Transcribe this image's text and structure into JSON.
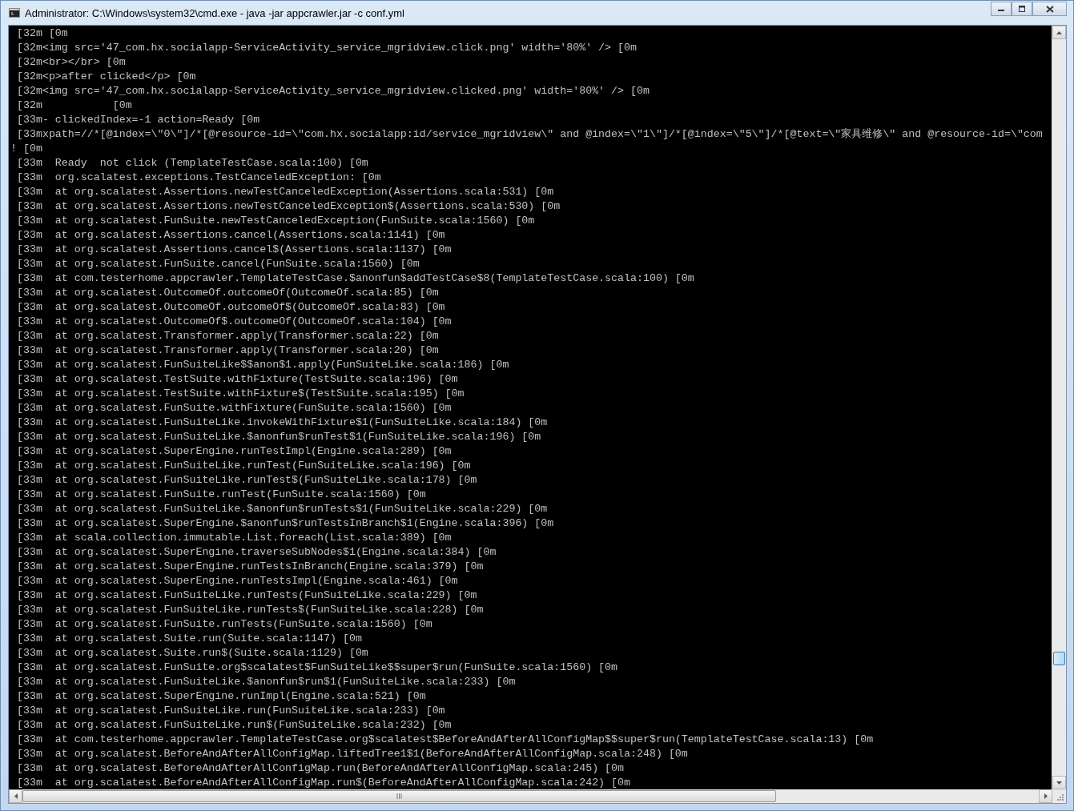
{
  "window": {
    "title": "Administrator: C:\\Windows\\system32\\cmd.exe - java  -jar appcrawler.jar -c conf.yml"
  },
  "console": {
    "lines": [
      " [32m [0m",
      " [32m<img src='47_com.hx.socialapp-ServiceActivity_service_mgridview.click.png' width='80%' /> [0m",
      " [32m<br></br> [0m",
      " [32m<p>after clicked</p> [0m",
      " [32m<img src='47_com.hx.socialapp-ServiceActivity_service_mgridview.clicked.png' width='80%' /> [0m",
      " [32m           [0m",
      " [33m- clickedIndex=-1 action=Ready [0m",
      " [33mxpath=//*[@index=\\\"0\\\"]/*[@resource-id=\\\"com.hx.socialapp:id/service_mgridview\\\" and @index=\\\"1\\\"]/*[@index=\\\"5\\\"]/*[@text=\\\"家具维修\\\" and @resource-id=\\\"com",
      "! [0m",
      " [33m  Ready  not click (TemplateTestCase.scala:100) [0m",
      " [33m  org.scalatest.exceptions.TestCanceledException: [0m",
      " [33m  at org.scalatest.Assertions.newTestCanceledException(Assertions.scala:531) [0m",
      " [33m  at org.scalatest.Assertions.newTestCanceledException$(Assertions.scala:530) [0m",
      " [33m  at org.scalatest.FunSuite.newTestCanceledException(FunSuite.scala:1560) [0m",
      " [33m  at org.scalatest.Assertions.cancel(Assertions.scala:1141) [0m",
      " [33m  at org.scalatest.Assertions.cancel$(Assertions.scala:1137) [0m",
      " [33m  at org.scalatest.FunSuite.cancel(FunSuite.scala:1560) [0m",
      " [33m  at com.testerhome.appcrawler.TemplateTestCase.$anonfun$addTestCase$8(TemplateTestCase.scala:100) [0m",
      " [33m  at org.scalatest.OutcomeOf.outcomeOf(OutcomeOf.scala:85) [0m",
      " [33m  at org.scalatest.OutcomeOf.outcomeOf$(OutcomeOf.scala:83) [0m",
      " [33m  at org.scalatest.OutcomeOf$.outcomeOf(OutcomeOf.scala:104) [0m",
      " [33m  at org.scalatest.Transformer.apply(Transformer.scala:22) [0m",
      " [33m  at org.scalatest.Transformer.apply(Transformer.scala:20) [0m",
      " [33m  at org.scalatest.FunSuiteLike$$anon$1.apply(FunSuiteLike.scala:186) [0m",
      " [33m  at org.scalatest.TestSuite.withFixture(TestSuite.scala:196) [0m",
      " [33m  at org.scalatest.TestSuite.withFixture$(TestSuite.scala:195) [0m",
      " [33m  at org.scalatest.FunSuite.withFixture(FunSuite.scala:1560) [0m",
      " [33m  at org.scalatest.FunSuiteLike.invokeWithFixture$1(FunSuiteLike.scala:184) [0m",
      " [33m  at org.scalatest.FunSuiteLike.$anonfun$runTest$1(FunSuiteLike.scala:196) [0m",
      " [33m  at org.scalatest.SuperEngine.runTestImpl(Engine.scala:289) [0m",
      " [33m  at org.scalatest.FunSuiteLike.runTest(FunSuiteLike.scala:196) [0m",
      " [33m  at org.scalatest.FunSuiteLike.runTest$(FunSuiteLike.scala:178) [0m",
      " [33m  at org.scalatest.FunSuite.runTest(FunSuite.scala:1560) [0m",
      " [33m  at org.scalatest.FunSuiteLike.$anonfun$runTests$1(FunSuiteLike.scala:229) [0m",
      " [33m  at org.scalatest.SuperEngine.$anonfun$runTestsInBranch$1(Engine.scala:396) [0m",
      " [33m  at scala.collection.immutable.List.foreach(List.scala:389) [0m",
      " [33m  at org.scalatest.SuperEngine.traverseSubNodes$1(Engine.scala:384) [0m",
      " [33m  at org.scalatest.SuperEngine.runTestsInBranch(Engine.scala:379) [0m",
      " [33m  at org.scalatest.SuperEngine.runTestsImpl(Engine.scala:461) [0m",
      " [33m  at org.scalatest.FunSuiteLike.runTests(FunSuiteLike.scala:229) [0m",
      " [33m  at org.scalatest.FunSuiteLike.runTests$(FunSuiteLike.scala:228) [0m",
      " [33m  at org.scalatest.FunSuite.runTests(FunSuite.scala:1560) [0m",
      " [33m  at org.scalatest.Suite.run(Suite.scala:1147) [0m",
      " [33m  at org.scalatest.Suite.run$(Suite.scala:1129) [0m",
      " [33m  at org.scalatest.FunSuite.org$scalatest$FunSuiteLike$$super$run(FunSuite.scala:1560) [0m",
      " [33m  at org.scalatest.FunSuiteLike.$anonfun$run$1(FunSuiteLike.scala:233) [0m",
      " [33m  at org.scalatest.SuperEngine.runImpl(Engine.scala:521) [0m",
      " [33m  at org.scalatest.FunSuiteLike.run(FunSuiteLike.scala:233) [0m",
      " [33m  at org.scalatest.FunSuiteLike.run$(FunSuiteLike.scala:232) [0m",
      " [33m  at com.testerhome.appcrawler.TemplateTestCase.org$scalatest$BeforeAndAfterAllConfigMap$$super$run(TemplateTestCase.scala:13) [0m",
      " [33m  at org.scalatest.BeforeAndAfterAllConfigMap.liftedTree1$1(BeforeAndAfterAllConfigMap.scala:248) [0m",
      " [33m  at org.scalatest.BeforeAndAfterAllConfigMap.run(BeforeAndAfterAllConfigMap.scala:245) [0m",
      " [33m  at org.scalatest.BeforeAndAfterAllConfigMap.run$(BeforeAndAfterAllConfigMap.scala:242) [0m"
    ]
  }
}
